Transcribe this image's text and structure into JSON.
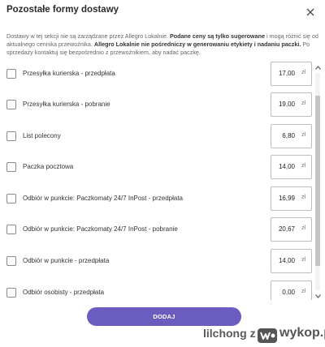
{
  "dialog": {
    "title": "Pozostałe formy dostawy",
    "description_parts": [
      {
        "text": "Dostawy w tej sekcji nie są zarządzane przez Allegro Lokalnie. ",
        "bold": false
      },
      {
        "text": "Podane ceny są tylko sugerowane",
        "bold": true
      },
      {
        "text": " i mogą różnić się od aktualnego cennika przewoźnika. ",
        "bold": false
      },
      {
        "text": "Allegro Lokalnie nie pośredniczy w generowaniu etykiety i nadaniu paczki.",
        "bold": true
      },
      {
        "text": " Po sprzedaży kontaktuj się bezpośrednio z przewoźnikiem, aby nadać paczkę.",
        "bold": false
      }
    ],
    "options": [
      {
        "label": "Przesyłka kurierska - przedpłata",
        "price": "17,00",
        "currency": "zł",
        "checked": false
      },
      {
        "label": "Przesyłka kurierska - pobranie",
        "price": "19,00",
        "currency": "zł",
        "checked": false
      },
      {
        "label": "List polecony",
        "price": "6,80",
        "currency": "zł",
        "checked": false
      },
      {
        "label": "Paczka pocztowa",
        "price": "14,00",
        "currency": "zł",
        "checked": false
      },
      {
        "label": "Odbiór w punkcie: Paczkomaty 24/7 InPost - przedpłata",
        "price": "16,99",
        "currency": "zł",
        "checked": false
      },
      {
        "label": "Odbiór w punkcie: Paczkomaty 24/7 InPost - pobranie",
        "price": "20,67",
        "currency": "zł",
        "checked": false
      },
      {
        "label": "Odbiór w punkcie - przedpłata",
        "price": "14,00",
        "currency": "zł",
        "checked": false
      },
      {
        "label": "Odbiór osobisty - przedpłata",
        "price": "0,00",
        "currency": "zł",
        "checked": false
      }
    ],
    "add_button_label": "DODAJ"
  },
  "watermark": {
    "user": "lilchong",
    "separator": "z",
    "site": "wykop.pl"
  },
  "colors": {
    "accent": "#6b5cc0",
    "border": "#bdbdbd"
  }
}
